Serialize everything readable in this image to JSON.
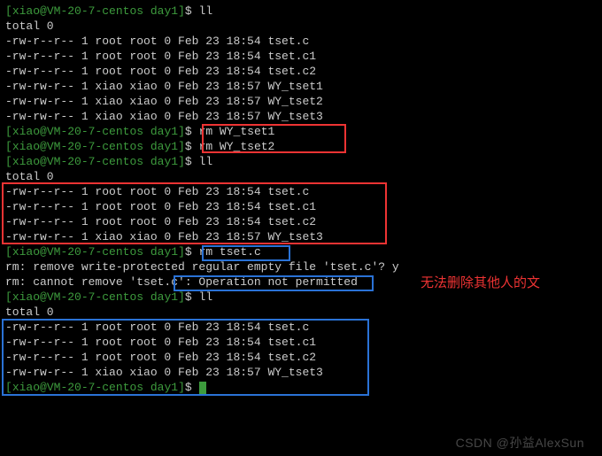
{
  "prompt": {
    "user": "xiao",
    "host": "VM-20-7-centos",
    "dir": "day1",
    "symbol": "$"
  },
  "commands": {
    "ll": "ll",
    "rm1": "rm WY_tset1",
    "rm2": "rm WY_tset2",
    "rm3": "rm tset.c"
  },
  "total": "total 0",
  "listing1": [
    "-rw-r--r-- 1 root root 0 Feb 23 18:54 tset.c",
    "-rw-r--r-- 1 root root 0 Feb 23 18:54 tset.c1",
    "-rw-r--r-- 1 root root 0 Feb 23 18:54 tset.c2",
    "-rw-rw-r-- 1 xiao xiao 0 Feb 23 18:57 WY_tset1",
    "-rw-rw-r-- 1 xiao xiao 0 Feb 23 18:57 WY_tset2",
    "-rw-rw-r-- 1 xiao xiao 0 Feb 23 18:57 WY_tset3"
  ],
  "listing2": [
    "-rw-r--r-- 1 root root 0 Feb 23 18:54 tset.c",
    "-rw-r--r-- 1 root root 0 Feb 23 18:54 tset.c1",
    "-rw-r--r-- 1 root root 0 Feb 23 18:54 tset.c2",
    "-rw-rw-r-- 1 xiao xiao 0 Feb 23 18:57 WY_tset3"
  ],
  "rm_output": {
    "confirm": "rm: remove write-protected regular empty file 'tset.c'? y",
    "error": "rm: cannot remove 'tset.c': Operation not permitted"
  },
  "listing3": [
    "-rw-r--r-- 1 root root 0 Feb 23 18:54 tset.c",
    "-rw-r--r-- 1 root root 0 Feb 23 18:54 tset.c1",
    "-rw-r--r-- 1 root root 0 Feb 23 18:54 tset.c2",
    "-rw-rw-r-- 1 xiao xiao 0 Feb 23 18:57 WY_tset3"
  ],
  "annotation": "无法删除其他人的文",
  "watermark": "CSDN @孙益AlexSun"
}
